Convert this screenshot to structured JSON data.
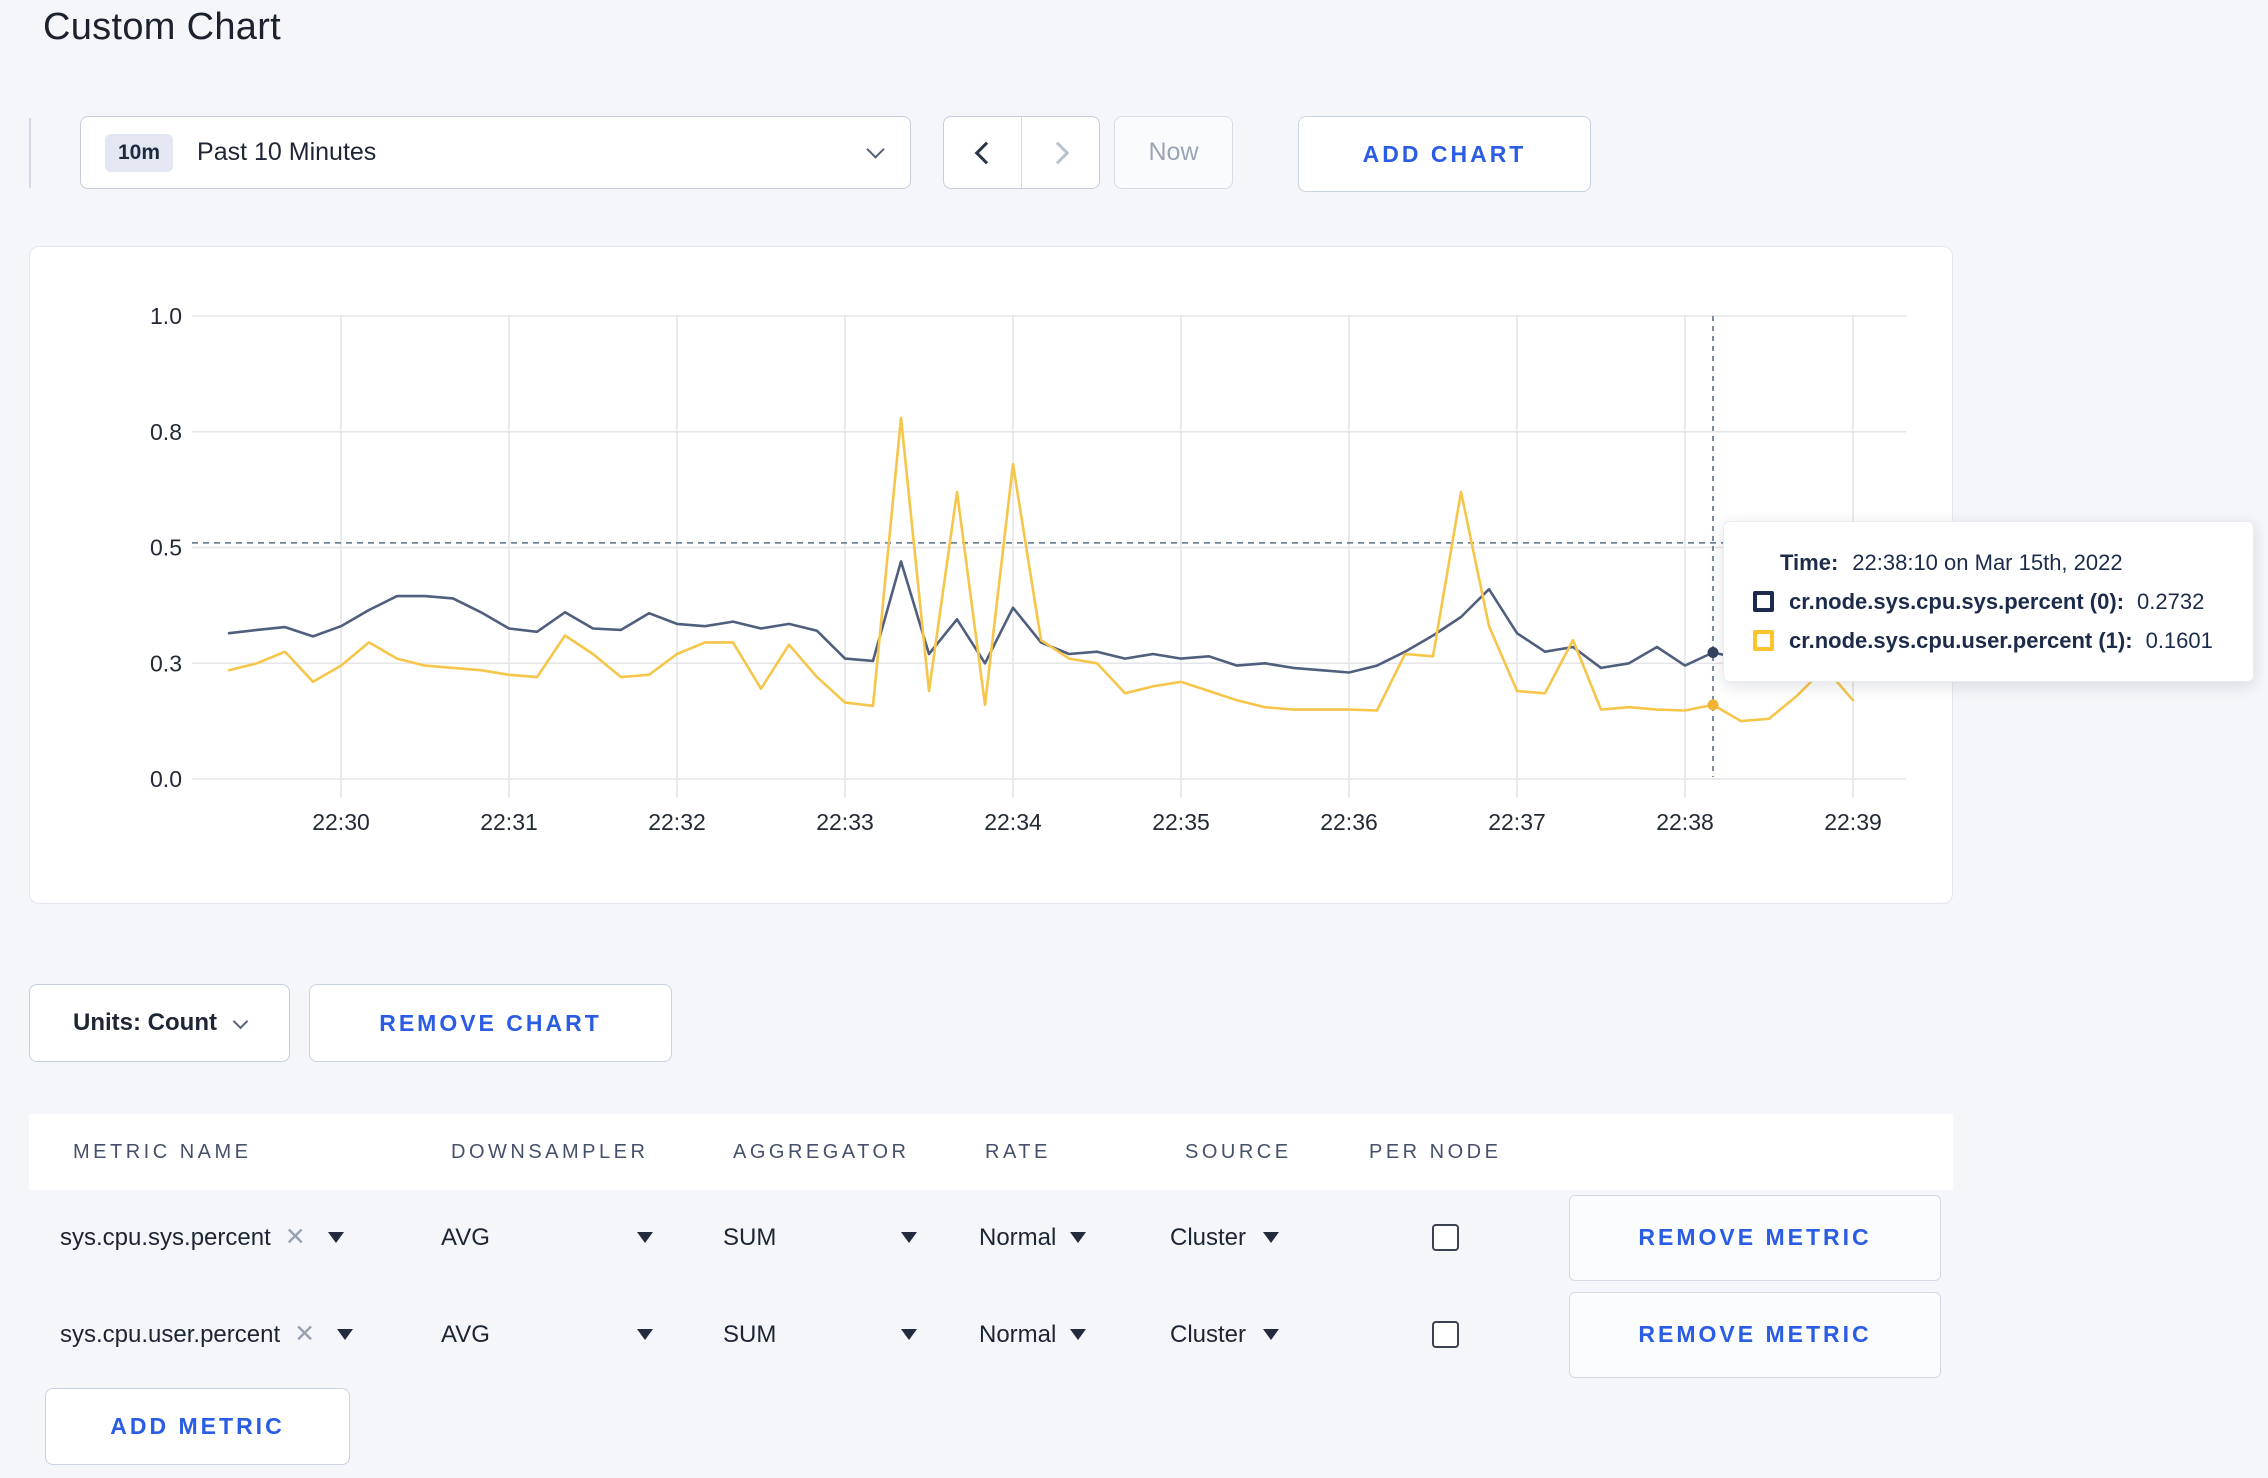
{
  "page": {
    "title": "Custom Chart"
  },
  "theme": {
    "accent_blue": "#2a5ce4",
    "page_bg": "#f4f6f9",
    "grid_color": "#e4e5e8",
    "crosshair_color": "#5a7086",
    "axis_text": "#232a35"
  },
  "toolbar": {
    "time_range": {
      "badge": "10m",
      "label": "Past 10 Minutes"
    },
    "now_label": "Now",
    "add_chart_label": "ADD CHART"
  },
  "icons": {
    "time_range_caret": "chevron-down-icon",
    "prev": "chevron-left-icon",
    "next": "chevron-right-icon",
    "units_caret": "chevron-down-icon",
    "select_caret": "caret-down-icon",
    "remove_tag_glyph": "✕"
  },
  "tooltip": {
    "time_label": "Time:",
    "time_value": "22:38:10 on Mar 15th, 2022",
    "series": [
      {
        "name": "cr.node.sys.cpu.sys.percent (0):",
        "value": "0.2732",
        "swatch_color": "#1c2b4d"
      },
      {
        "name": "cr.node.sys.cpu.user.percent (1):",
        "value": "0.1601",
        "swatch_color": "#ffc32e"
      }
    ]
  },
  "chart_controls": {
    "units_label": "Units: Count",
    "remove_chart_label": "REMOVE CHART",
    "add_metric_label": "ADD METRIC"
  },
  "metrics_table": {
    "headers": [
      "METRIC NAME",
      "DOWNSAMPLER",
      "AGGREGATOR",
      "RATE",
      "SOURCE",
      "PER NODE"
    ],
    "rows": [
      {
        "metric_name": "sys.cpu.sys.percent",
        "downsampler": "AVG",
        "aggregator": "SUM",
        "rate": "Normal",
        "source": "Cluster",
        "per_node_checked": false,
        "remove_label": "REMOVE METRIC"
      },
      {
        "metric_name": "sys.cpu.user.percent",
        "downsampler": "AVG",
        "aggregator": "SUM",
        "rate": "Normal",
        "source": "Cluster",
        "per_node_checked": false,
        "remove_label": "REMOVE METRIC"
      }
    ]
  },
  "chart_data": {
    "type": "line",
    "title": "",
    "xlabel": "",
    "ylabel": "",
    "ylim": [
      0,
      1
    ],
    "grid": true,
    "legend_position": "tooltip",
    "y_ticks": {
      "values": [
        0,
        0.25,
        0.5,
        0.75,
        1.0
      ],
      "labels": [
        "0.0",
        "0.3",
        "0.5",
        "0.8",
        "1.0"
      ]
    },
    "x_ticks": [
      "22:30",
      "22:31",
      "22:32",
      "22:33",
      "22:34",
      "22:35",
      "22:36",
      "22:37",
      "22:38",
      "22:39"
    ],
    "x_first_tick": "22:30",
    "x_start": "22:29:20",
    "x_step_seconds": 10,
    "crosshair": {
      "time": "22:38:10",
      "index": 53,
      "hover_line_value": 0.51
    },
    "series": [
      {
        "name": "cr.node.sys.cpu.sys.percent",
        "color": "#4f5f7d",
        "dot_color": "#33435f",
        "values": [
          0.315,
          0.322,
          0.328,
          0.308,
          0.33,
          0.365,
          0.395,
          0.395,
          0.39,
          0.36,
          0.325,
          0.318,
          0.36,
          0.325,
          0.322,
          0.358,
          0.335,
          0.33,
          0.34,
          0.325,
          0.335,
          0.32,
          0.26,
          0.255,
          0.47,
          0.27,
          0.345,
          0.25,
          0.37,
          0.295,
          0.27,
          0.275,
          0.26,
          0.27,
          0.26,
          0.265,
          0.245,
          0.25,
          0.24,
          0.235,
          0.23,
          0.245,
          0.275,
          0.31,
          0.35,
          0.41,
          0.315,
          0.275,
          0.285,
          0.24,
          0.25,
          0.285,
          0.245,
          0.2732,
          0.26,
          0.27,
          0.285,
          0.29,
          0.28
        ]
      },
      {
        "name": "cr.node.sys.cpu.user.percent",
        "color": "#f6c64b",
        "dot_color": "#f0b332",
        "values": [
          0.235,
          0.25,
          0.275,
          0.21,
          0.245,
          0.295,
          0.26,
          0.245,
          0.24,
          0.235,
          0.225,
          0.22,
          0.31,
          0.27,
          0.22,
          0.225,
          0.27,
          0.295,
          0.295,
          0.195,
          0.29,
          0.22,
          0.165,
          0.158,
          0.78,
          0.19,
          0.62,
          0.16,
          0.68,
          0.3,
          0.26,
          0.25,
          0.185,
          0.2,
          0.21,
          0.19,
          0.17,
          0.155,
          0.15,
          0.15,
          0.15,
          0.148,
          0.27,
          0.265,
          0.62,
          0.33,
          0.19,
          0.185,
          0.3,
          0.15,
          0.155,
          0.15,
          0.148,
          0.1601,
          0.125,
          0.13,
          0.18,
          0.24,
          0.17
        ]
      }
    ]
  }
}
